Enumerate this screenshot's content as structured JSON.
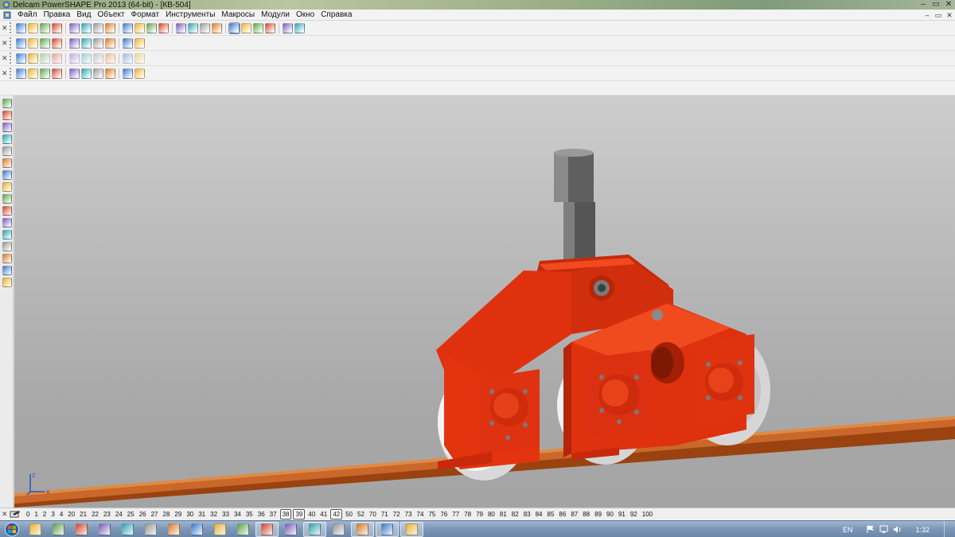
{
  "window": {
    "title": "Delcam PowerSHAPE Pro 2013 (64-bit) - [КВ-504]",
    "controls": [
      "–",
      "▭",
      "✕"
    ]
  },
  "menu": {
    "items": [
      "Файл",
      "Правка",
      "Вид",
      "Объект",
      "Формат",
      "Инструменты",
      "Макросы",
      "Модули",
      "Окно",
      "Справка"
    ],
    "doc_controls": [
      "–",
      "▭",
      "✕"
    ]
  },
  "colors": {
    "model_red": "#e0310f",
    "rail_brown": "#b5531b",
    "wheel_white": "#ececec",
    "shaft_gray": "#6c6c6c",
    "viewport_top": "#cdcdcd",
    "viewport_bottom": "#a4a4a4"
  },
  "toolbars": {
    "main": [
      "new-file-icon",
      "open-file-icon",
      "save-icon",
      "print-icon",
      "cut-icon",
      "copy-icon",
      "paste-icon",
      "undo-icon",
      "redo-icon",
      "select-icon",
      "line-icon",
      "circle-icon",
      "curve-icon",
      "surface-icon",
      "solid-icon",
      "wireframe-icon",
      "zoom-icon",
      "pan-icon",
      "rotate-icon",
      "shade-icon",
      "light-icon",
      "view-icon"
    ],
    "view": [
      "view-top-icon",
      "view-front-icon",
      "view-right-icon",
      "view-iso-icon",
      "shaded-icon",
      "render-icon",
      "material-icon",
      "layer-icon",
      "workplane-icon",
      "measure-icon"
    ],
    "solid": [
      "solid-feature-icon",
      "extrude-icon",
      "revolve-icon",
      "fillet-icon",
      "chamfer-icon",
      "shell-icon",
      "boolean-add-icon",
      "boolean-subtract-icon",
      "intersect-icon",
      "split-icon"
    ],
    "assembly": [
      "select-part-icon",
      "move-icon",
      "rotate-part-icon",
      "copy-part-icon",
      "mirror-icon",
      "array-icon",
      "constraint-icon",
      "explode-icon",
      "hide-icon",
      "show-icon"
    ]
  },
  "left_toolbar": [
    "select-icon",
    "line-icon",
    "arc-icon",
    "curve-icon",
    "surface-icon",
    "solid-icon",
    "dimension-icon",
    "text-icon",
    "workplane-icon",
    "symbol-icon",
    "mesh-icon",
    "electrode-icon",
    "sheet-metal-icon",
    "model-icon",
    "assembly-icon",
    "render-icon"
  ],
  "axis_triad": {
    "x_label": "X",
    "y_label": "Y",
    "z_label": "Z"
  },
  "layers": {
    "items": [
      "0",
      "1",
      "2",
      "3",
      "4",
      "20",
      "21",
      "22",
      "23",
      "24",
      "25",
      "26",
      "27",
      "28",
      "29",
      "30",
      "31",
      "32",
      "33",
      "34",
      "35",
      "36",
      "37",
      "38",
      "39",
      "40",
      "41",
      "42",
      "50",
      "52",
      "70",
      "71",
      "72",
      "73",
      "74",
      "75",
      "76",
      "77",
      "78",
      "79",
      "80",
      "81",
      "82",
      "83",
      "84",
      "85",
      "86",
      "87",
      "88",
      "89",
      "90",
      "91",
      "92",
      "100"
    ],
    "boxed": [
      "38",
      "39",
      "42"
    ]
  },
  "taskbar": {
    "apps": [
      {
        "icon": "explorer-icon",
        "active": false
      },
      {
        "icon": "folder-icon",
        "active": false
      },
      {
        "icon": "firefox-icon",
        "active": false
      },
      {
        "icon": "excel-icon",
        "active": false
      },
      {
        "icon": "word-icon",
        "active": false
      },
      {
        "icon": "calculator-icon",
        "active": false
      },
      {
        "icon": "notepad-icon",
        "active": false
      },
      {
        "icon": "media-player-icon",
        "active": false
      },
      {
        "icon": "terminal-icon",
        "active": false
      },
      {
        "icon": "video-icon",
        "active": false
      },
      {
        "icon": "image-viewer-icon",
        "active": true
      },
      {
        "icon": "save-disk-icon",
        "active": false
      },
      {
        "icon": "powershape-icon",
        "active": true
      },
      {
        "icon": "chart-icon",
        "active": false
      },
      {
        "icon": "photoshop-icon",
        "active": true
      },
      {
        "icon": "premiere-icon",
        "active": true
      },
      {
        "icon": "delcam-icon",
        "active": true
      }
    ],
    "tray": {
      "language": "EN",
      "time": "1:32"
    }
  }
}
